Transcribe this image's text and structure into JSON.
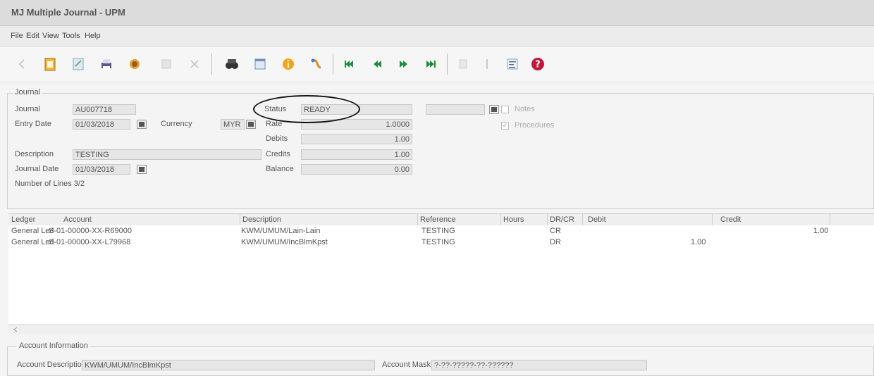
{
  "window": {
    "title": "MJ Multiple Journal - UPM"
  },
  "menu": {
    "file": "File",
    "edit": "Edit",
    "view": "View",
    "tools": "Tools",
    "help": "Help"
  },
  "toolbar": {
    "icons": [
      "back-arrow-icon",
      "new-document-icon",
      "edit-document-icon",
      "print-icon",
      "search-document-icon",
      "save-icon",
      "delete-icon",
      "binoculars-icon",
      "window-icon",
      "info-icon",
      "attach-icon",
      "first-record-icon",
      "previous-record-icon",
      "next-record-icon",
      "last-record-icon",
      "post-icon",
      "sort-icon",
      "list-icon",
      "help-icon"
    ]
  },
  "journal_group": {
    "legend": "Journal",
    "journal_label": "Journal",
    "journal_value": "AU007718",
    "entry_date_label": "Entry Date",
    "entry_date_value": "01/03/2018",
    "currency_label": "Currency",
    "currency_value": "MYR",
    "status_label": "Status",
    "status_value": "READY",
    "rate_label": "Rate",
    "rate_value": "1.0000",
    "debits_label": "Debits",
    "debits_value": "1.00",
    "credits_label": "Credits",
    "credits_value": "1.00",
    "balance_label": "Balance",
    "balance_value": "0.00",
    "description_label": "Description",
    "description_value": "TESTING",
    "journal_date_label": "Journal Date",
    "journal_date_value": "01/03/2018",
    "lines_label": "Number of Lines 3/2",
    "notes_label": "Notes",
    "procedures_label": "Procedures",
    "procedures_checked": true
  },
  "grid": {
    "headers": [
      "Ledger",
      "Account",
      "Description",
      "Reference",
      "Hours",
      "DR/CR",
      "Debit",
      "Credit"
    ],
    "rows": [
      [
        "General Led",
        "S-01-00000-XX-R69000",
        "KWM/UMUM/Lain-Lain",
        "TESTING",
        "",
        "CR",
        "",
        "1.00"
      ],
      [
        "General Led",
        "S-01-00000-XX-L79968",
        "KWM/UMUM/IncBlmKpst",
        "TESTING",
        "",
        "DR",
        "1.00",
        ""
      ]
    ]
  },
  "account_info": {
    "legend": "Account Information",
    "account_description_label": "Account Description",
    "account_description_value": "KWM/UMUM/IncBlmKpst",
    "account_mask_label": "Account Mask",
    "account_mask_value": "?-??-?????-??-??????"
  }
}
